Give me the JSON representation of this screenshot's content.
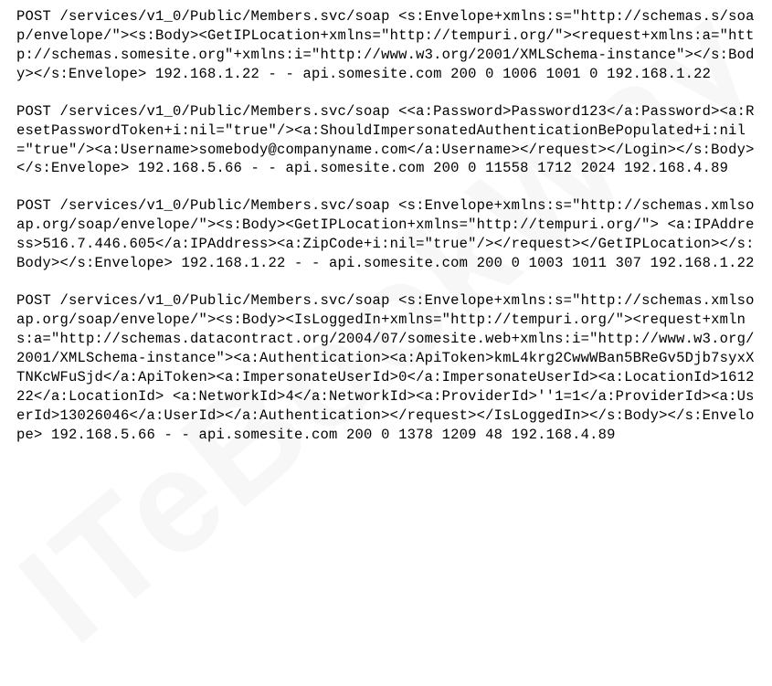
{
  "watermark": "ITeBookWay",
  "log_entries": [
    "POST /services/v1_0/Public/Members.svc/soap <s:Envelope+xmlns:s=\"http://schemas.s/soap/envelope/\"><s:Body><GetIPLocation+xmlns=\"http://tempuri.org/\"><request+xmlns:a=\"http://schemas.somesite.org\"+xmlns:i=\"http://www.w3.org/2001/XMLSchema-instance\"></s:Body></s:Envelope> 192.168.1.22 - - api.somesite.com 200 0 1006 1001 0 192.168.1.22",
    "POST /services/v1_0/Public/Members.svc/soap <<a:Password>Password123</a:Password><a:ResetPasswordToken+i:nil=\"true\"/><a:ShouldImpersonatedAuthenticationBePopulated+i:nil=\"true\"/><a:Username>somebody@companyname.com</a:Username></request></Login></s:Body></s:Envelope> 192.168.5.66 - - api.somesite.com 200 0 11558 1712 2024 192.168.4.89",
    "POST /services/v1_0/Public/Members.svc/soap <s:Envelope+xmlns:s=\"http://schemas.xmlsoap.org/soap/envelope/\"><s:Body><GetIPLocation+xmlns=\"http://tempuri.org/\"> <a:IPAddress>516.7.446.605</a:IPAddress><a:ZipCode+i:nil=\"true\"/></request></GetIPLocation></s:Body></s:Envelope> 192.168.1.22 - - api.somesite.com 200 0 1003 1011 307 192.168.1.22",
    "POST /services/v1_0/Public/Members.svc/soap <s:Envelope+xmlns:s=\"http://schemas.xmlsoap.org/soap/envelope/\"><s:Body><IsLoggedIn+xmlns=\"http://tempuri.org/\"><request+xmlns:a=\"http://schemas.datacontract.org/2004/07/somesite.web+xmlns:i=\"http://www.w3.org/2001/XMLSchema-instance\"><a:Authentication><a:ApiToken>kmL4krg2CwwWBan5BReGv5Djb7syxXTNKcWFuSjd</a:ApiToken><a:ImpersonateUserId>0</a:ImpersonateUserId><a:LocationId>161222</a:LocationId> <a:NetworkId>4</a:NetworkId><a:ProviderId>''1=1</a:ProviderId><a:UserId>13026046</a:UserId></a:Authentication></request></IsLoggedIn></s:Body></s:Envelope> 192.168.5.66 - - api.somesite.com 200 0 1378 1209 48 192.168.4.89"
  ]
}
